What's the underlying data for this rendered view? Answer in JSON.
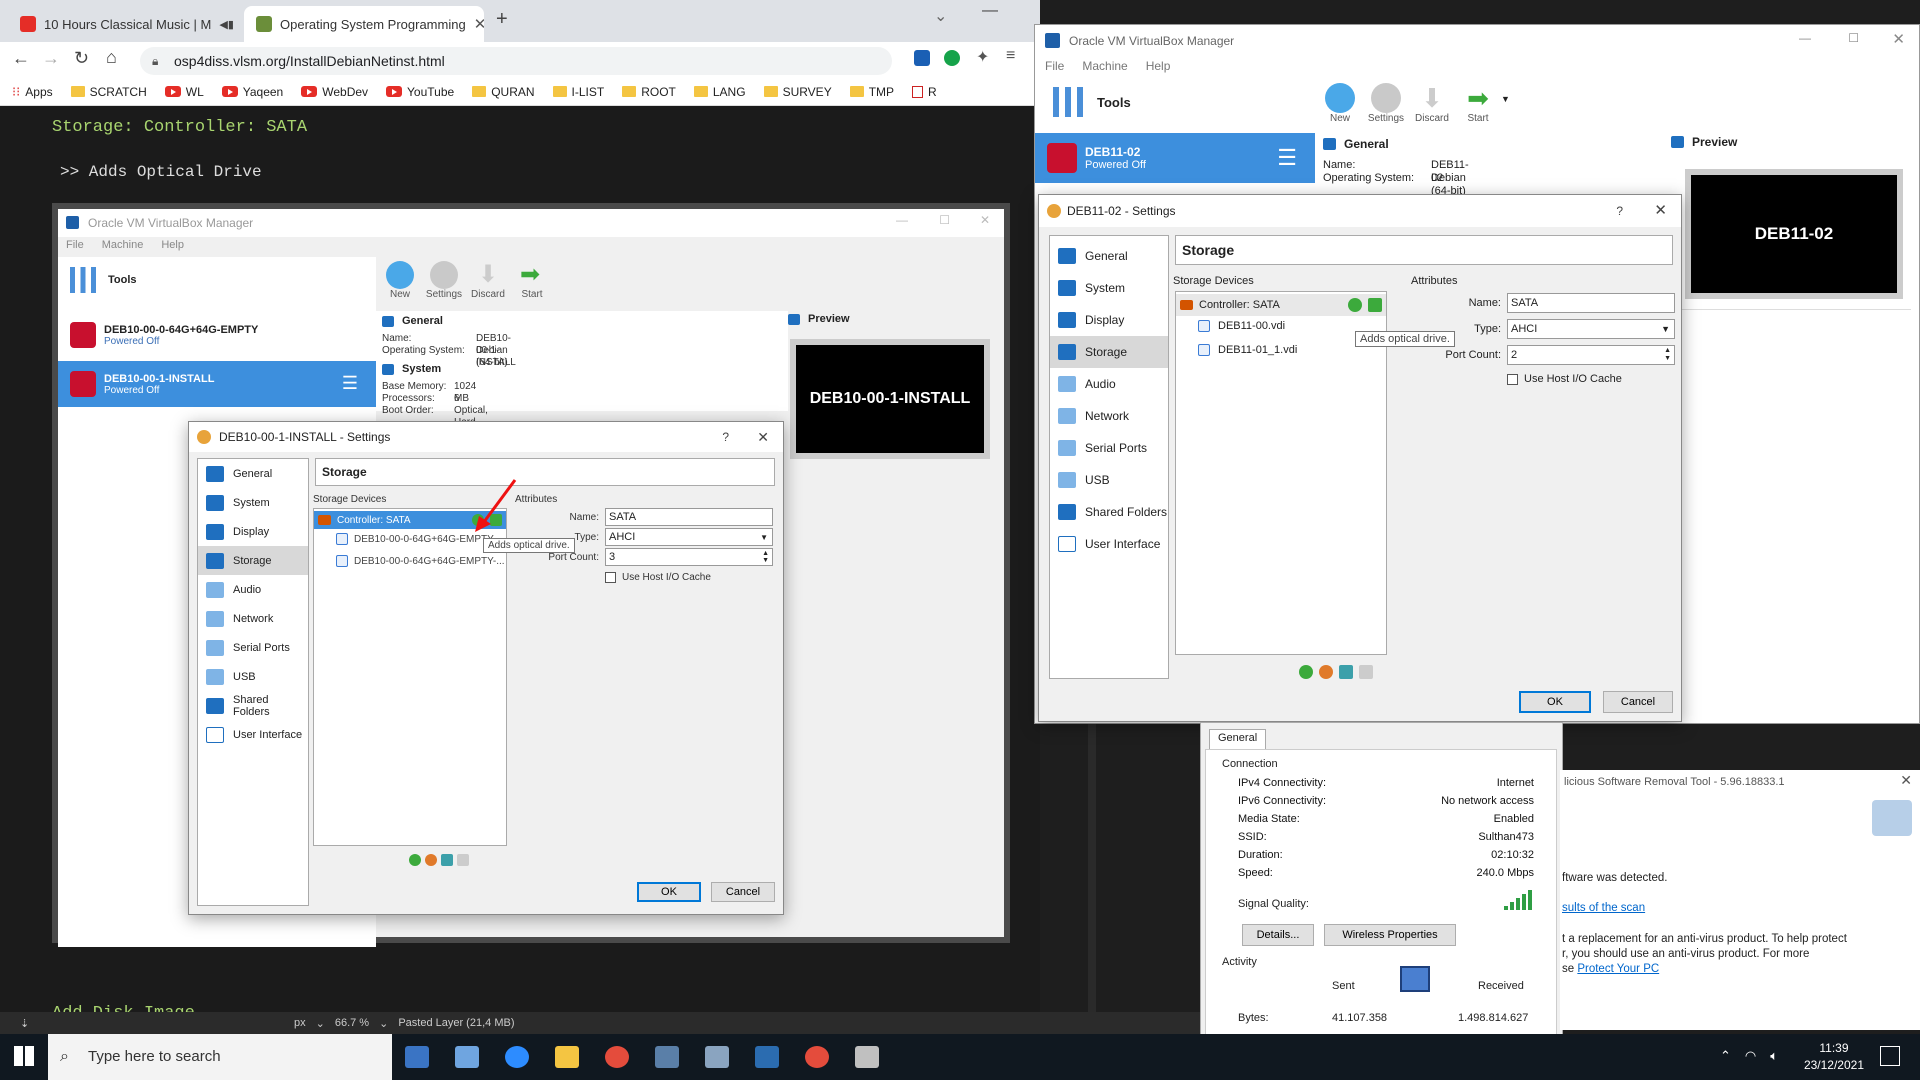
{
  "browser": {
    "tabs": [
      {
        "title": "10 Hours Classical Music | M"
      },
      {
        "title": "Operating System Programming"
      }
    ],
    "url": "osp4diss.vlsm.org/InstallDebianNetinst.html",
    "bookmarks": [
      "Apps",
      "SCRATCH",
      "WL",
      "Yaqeen",
      "WebDev",
      "YouTube",
      "QURAN",
      "I-LIST",
      "ROOT",
      "LANG",
      "SURVEY",
      "TMP",
      "R"
    ],
    "page": {
      "line1": "Storage: Controller: SATA",
      "line2": ">> Adds Optical Drive",
      "line3": "Add Disk Image"
    },
    "editorbar": {
      "unit": "px",
      "zoom": "66.7 %",
      "layer": "Pasted Layer (21,4 MB)"
    }
  },
  "inner": {
    "app_title": "Oracle VM VirtualBox Manager",
    "menu": [
      "File",
      "Machine",
      "Help"
    ],
    "tools_label": "Tools",
    "toolbar": [
      "New",
      "Settings",
      "Discard",
      "Start"
    ],
    "vms": [
      {
        "name": "DEB10-00-0-64G+64G-EMPTY",
        "status": "Powered Off"
      },
      {
        "name": "DEB10-00-1-INSTALL",
        "status": "Powered Off"
      }
    ],
    "general": {
      "title": "General",
      "name_label": "Name:",
      "name": "DEB10-00-1-INSTALL",
      "os_label": "Operating System:",
      "os": "Debian (64-bit)"
    },
    "system": {
      "title": "System",
      "mem_label": "Base Memory:",
      "mem": "1024 MB",
      "proc_label": "Processors:",
      "proc": "6",
      "boot_label": "Boot Order:",
      "boot": "Optical, Hard Disk"
    },
    "preview": {
      "title": "Preview",
      "text": "DEB10-00-1-INSTALL"
    },
    "dialog": {
      "title": "DEB10-00-1-INSTALL - Settings",
      "help": "?",
      "nav": [
        "General",
        "System",
        "Display",
        "Storage",
        "Audio",
        "Network",
        "Serial Ports",
        "USB",
        "Shared Folders",
        "User Interface"
      ],
      "pane": "Storage",
      "storage_devices": "Storage Devices",
      "controller": "Controller: SATA",
      "disks": [
        "DEB10-00-0-64G+64G-EMPTY...",
        "DEB10-00-0-64G+64G-EMPTY-..."
      ],
      "tooltip": "Adds optical drive.",
      "attributes": "Attributes",
      "name_label": "Name:",
      "name_value": "SATA",
      "type_label": "Type:",
      "type_value": "AHCI",
      "port_label": "Port Count:",
      "port_value": "3",
      "cache_label": "Use Host I/O Cache",
      "ok": "OK",
      "cancel": "Cancel"
    }
  },
  "vbox": {
    "title": "Oracle VM VirtualBox Manager",
    "menu": [
      "File",
      "Machine",
      "Help"
    ],
    "tools_label": "Tools",
    "toolbar": [
      "New",
      "Settings",
      "Discard",
      "Start"
    ],
    "vm": {
      "name": "DEB11-02",
      "status": "Powered Off"
    },
    "general": {
      "title": "General",
      "name_label": "Name:",
      "name": "DEB11-02",
      "os_label": "Operating System:",
      "os": "Debian (64-bit)"
    },
    "preview": {
      "title": "Preview",
      "text": "DEB11-02"
    },
    "dialog": {
      "title": "DEB11-02 - Settings",
      "help": "?",
      "nav": [
        "General",
        "System",
        "Display",
        "Storage",
        "Audio",
        "Network",
        "Serial Ports",
        "USB",
        "Shared Folders",
        "User Interface"
      ],
      "pane": "Storage",
      "storage_devices": "Storage Devices",
      "controller": "Controller: SATA",
      "disks": [
        "DEB11-00.vdi",
        "DEB11-01_1.vdi"
      ],
      "tooltip": "Adds optical drive.",
      "attributes": "Attributes",
      "name_label": "Name:",
      "name_value": "SATA",
      "type_label": "Type:",
      "type_value": "AHCI",
      "port_label": "Port Count:",
      "port_value": "2",
      "cache_label": "Use Host I/O Cache",
      "ok": "OK",
      "cancel": "Cancel"
    }
  },
  "network": {
    "tab": "General",
    "connection": "Connection",
    "rows": [
      {
        "k": "IPv4 Connectivity:",
        "v": "Internet"
      },
      {
        "k": "IPv6 Connectivity:",
        "v": "No network access"
      },
      {
        "k": "Media State:",
        "v": "Enabled"
      },
      {
        "k": "SSID:",
        "v": "Sulthan473"
      },
      {
        "k": "Duration:",
        "v": "02:10:32"
      },
      {
        "k": "Speed:",
        "v": "240.0 Mbps"
      }
    ],
    "signal_label": "Signal Quality:",
    "signal_level": 5,
    "details_btn": "Details...",
    "wireless_btn": "Wireless Properties",
    "activity": "Activity",
    "sent": "Sent",
    "received": "Received",
    "bytes_label": "Bytes:",
    "bytes_sent": "41.107.358",
    "bytes_received": "1.498.814.627"
  },
  "msrt": {
    "title": "licious Software Removal Tool - 5.96.18833.1",
    "line1": "ftware was detected.",
    "link1": "sults of the scan",
    "line2a": "t a replacement for an anti-virus product. To help protect",
    "line2b": "r, you should use an anti-virus product. For more",
    "line2c": "se ",
    "link2": "Protect Your PC"
  },
  "taskbar": {
    "search_placeholder": "Type here to search",
    "time": "11:39",
    "date": "23/12/2021"
  },
  "colors": {
    "accent_blue": "#3d8fdd",
    "terminal_green": "#a8d46f"
  }
}
